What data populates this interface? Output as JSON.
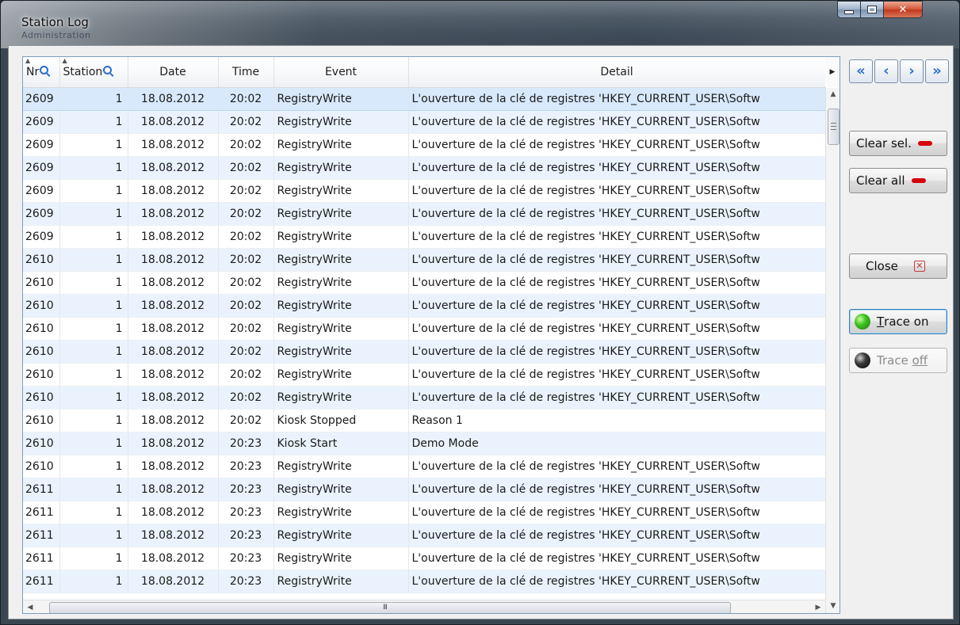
{
  "window": {
    "title": "Station Log",
    "background_caption": "Administration"
  },
  "columns": {
    "nr": "Nr",
    "station": "Station",
    "date": "Date",
    "time": "Time",
    "event": "Event",
    "detail": "Detail"
  },
  "rows": [
    {
      "nr": "2609",
      "station": "1",
      "date": "18.08.2012",
      "time": "20:02",
      "event": "RegistryWrite",
      "detail": "L'ouverture de la clé de registres 'HKEY_CURRENT_USER\\Softw"
    },
    {
      "nr": "2609",
      "station": "1",
      "date": "18.08.2012",
      "time": "20:02",
      "event": "RegistryWrite",
      "detail": "L'ouverture de la clé de registres 'HKEY_CURRENT_USER\\Softw"
    },
    {
      "nr": "2609",
      "station": "1",
      "date": "18.08.2012",
      "time": "20:02",
      "event": "RegistryWrite",
      "detail": "L'ouverture de la clé de registres 'HKEY_CURRENT_USER\\Softw"
    },
    {
      "nr": "2609",
      "station": "1",
      "date": "18.08.2012",
      "time": "20:02",
      "event": "RegistryWrite",
      "detail": "L'ouverture de la clé de registres 'HKEY_CURRENT_USER\\Softw"
    },
    {
      "nr": "2609",
      "station": "1",
      "date": "18.08.2012",
      "time": "20:02",
      "event": "RegistryWrite",
      "detail": "L'ouverture de la clé de registres 'HKEY_CURRENT_USER\\Softw"
    },
    {
      "nr": "2609",
      "station": "1",
      "date": "18.08.2012",
      "time": "20:02",
      "event": "RegistryWrite",
      "detail": "L'ouverture de la clé de registres 'HKEY_CURRENT_USER\\Softw"
    },
    {
      "nr": "2609",
      "station": "1",
      "date": "18.08.2012",
      "time": "20:02",
      "event": "RegistryWrite",
      "detail": "L'ouverture de la clé de registres 'HKEY_CURRENT_USER\\Softw"
    },
    {
      "nr": "2610",
      "station": "1",
      "date": "18.08.2012",
      "time": "20:02",
      "event": "RegistryWrite",
      "detail": "L'ouverture de la clé de registres 'HKEY_CURRENT_USER\\Softw"
    },
    {
      "nr": "2610",
      "station": "1",
      "date": "18.08.2012",
      "time": "20:02",
      "event": "RegistryWrite",
      "detail": "L'ouverture de la clé de registres 'HKEY_CURRENT_USER\\Softw"
    },
    {
      "nr": "2610",
      "station": "1",
      "date": "18.08.2012",
      "time": "20:02",
      "event": "RegistryWrite",
      "detail": "L'ouverture de la clé de registres 'HKEY_CURRENT_USER\\Softw"
    },
    {
      "nr": "2610",
      "station": "1",
      "date": "18.08.2012",
      "time": "20:02",
      "event": "RegistryWrite",
      "detail": "L'ouverture de la clé de registres 'HKEY_CURRENT_USER\\Softw"
    },
    {
      "nr": "2610",
      "station": "1",
      "date": "18.08.2012",
      "time": "20:02",
      "event": "RegistryWrite",
      "detail": "L'ouverture de la clé de registres 'HKEY_CURRENT_USER\\Softw"
    },
    {
      "nr": "2610",
      "station": "1",
      "date": "18.08.2012",
      "time": "20:02",
      "event": "RegistryWrite",
      "detail": "L'ouverture de la clé de registres 'HKEY_CURRENT_USER\\Softw"
    },
    {
      "nr": "2610",
      "station": "1",
      "date": "18.08.2012",
      "time": "20:02",
      "event": "RegistryWrite",
      "detail": "L'ouverture de la clé de registres 'HKEY_CURRENT_USER\\Softw"
    },
    {
      "nr": "2610",
      "station": "1",
      "date": "18.08.2012",
      "time": "20:02",
      "event": "Kiosk Stopped",
      "detail": "Reason 1"
    },
    {
      "nr": "2610",
      "station": "1",
      "date": "18.08.2012",
      "time": "20:23",
      "event": "Kiosk Start",
      "detail": "Demo Mode"
    },
    {
      "nr": "2610",
      "station": "1",
      "date": "18.08.2012",
      "time": "20:23",
      "event": "RegistryWrite",
      "detail": "L'ouverture de la clé de registres 'HKEY_CURRENT_USER\\Softw"
    },
    {
      "nr": "2611",
      "station": "1",
      "date": "18.08.2012",
      "time": "20:23",
      "event": "RegistryWrite",
      "detail": "L'ouverture de la clé de registres 'HKEY_CURRENT_USER\\Softw"
    },
    {
      "nr": "2611",
      "station": "1",
      "date": "18.08.2012",
      "time": "20:23",
      "event": "RegistryWrite",
      "detail": "L'ouverture de la clé de registres 'HKEY_CURRENT_USER\\Softw"
    },
    {
      "nr": "2611",
      "station": "1",
      "date": "18.08.2012",
      "time": "20:23",
      "event": "RegistryWrite",
      "detail": "L'ouverture de la clé de registres 'HKEY_CURRENT_USER\\Softw"
    },
    {
      "nr": "2611",
      "station": "1",
      "date": "18.08.2012",
      "time": "20:23",
      "event": "RegistryWrite",
      "detail": "L'ouverture de la clé de registres 'HKEY_CURRENT_USER\\Softw"
    },
    {
      "nr": "2611",
      "station": "1",
      "date": "18.08.2012",
      "time": "20:23",
      "event": "RegistryWrite",
      "detail": "L'ouverture de la clé de registres 'HKEY_CURRENT_USER\\Softw"
    }
  ],
  "selected_row": 0,
  "buttons": {
    "clear_sel": "Clear sel.",
    "clear_all": "Clear all",
    "close": "Close",
    "trace_on": "Trace on",
    "trace_on_mnemonic": "T",
    "trace_on_rest": "race on",
    "trace_off_pre": "Trace ",
    "trace_off_mnemonic": "off"
  },
  "nav": {
    "first": "«",
    "prev": "‹",
    "next": "›",
    "last": "»"
  },
  "scrollbar": {
    "grip": "III"
  },
  "colors": {
    "accent": "#2c6ed5",
    "row_alt": "#eaf3fd",
    "row_selected": "#d8e9fb",
    "indicator_red": "#d8000c",
    "trace_on_green": "#3dc120"
  },
  "icons": {
    "clear_sel": "red-dash-icon",
    "clear_all": "red-dash-icon",
    "close": "close-x-icon",
    "trace_on": "green-led-icon",
    "trace_off": "black-led-icon",
    "column_filter": "magnifier-icon",
    "sort": "sort-arrow-icon"
  }
}
